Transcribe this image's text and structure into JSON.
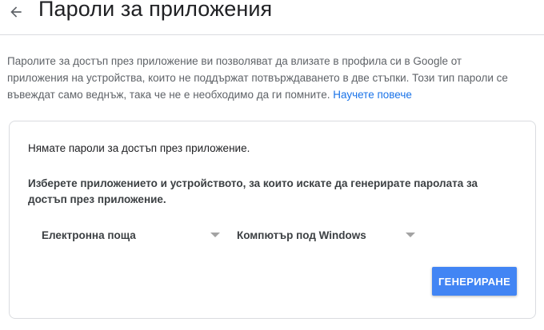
{
  "header": {
    "title": "Пароли за приложения",
    "back_icon": "arrow-left-icon"
  },
  "description": {
    "text": "Паролите за достъп през приложение ви позволяват да влизате в профила си в Google от приложения на устройства, които не поддържат потвърждаването в две стъпки. Този тип пароли се въвеждат само веднъж, така че не е необходимо да ги помните.",
    "link_label": "Научете повече",
    "link_color": "#1a73e8"
  },
  "card": {
    "no_passwords_text": "Нямате пароли за достъп през приложение.",
    "select_label": "Изберете приложението и устройството, за които искате да генерирате паролата за достъп през приложение.",
    "app_dropdown": {
      "selected": "Електронна поща",
      "icon": "caret-down-icon"
    },
    "device_dropdown": {
      "selected": "Компютър под Windows",
      "icon": "caret-down-icon"
    },
    "generate_button": {
      "label": "ГЕНЕРИРАНЕ",
      "color": "#4285f4"
    }
  }
}
